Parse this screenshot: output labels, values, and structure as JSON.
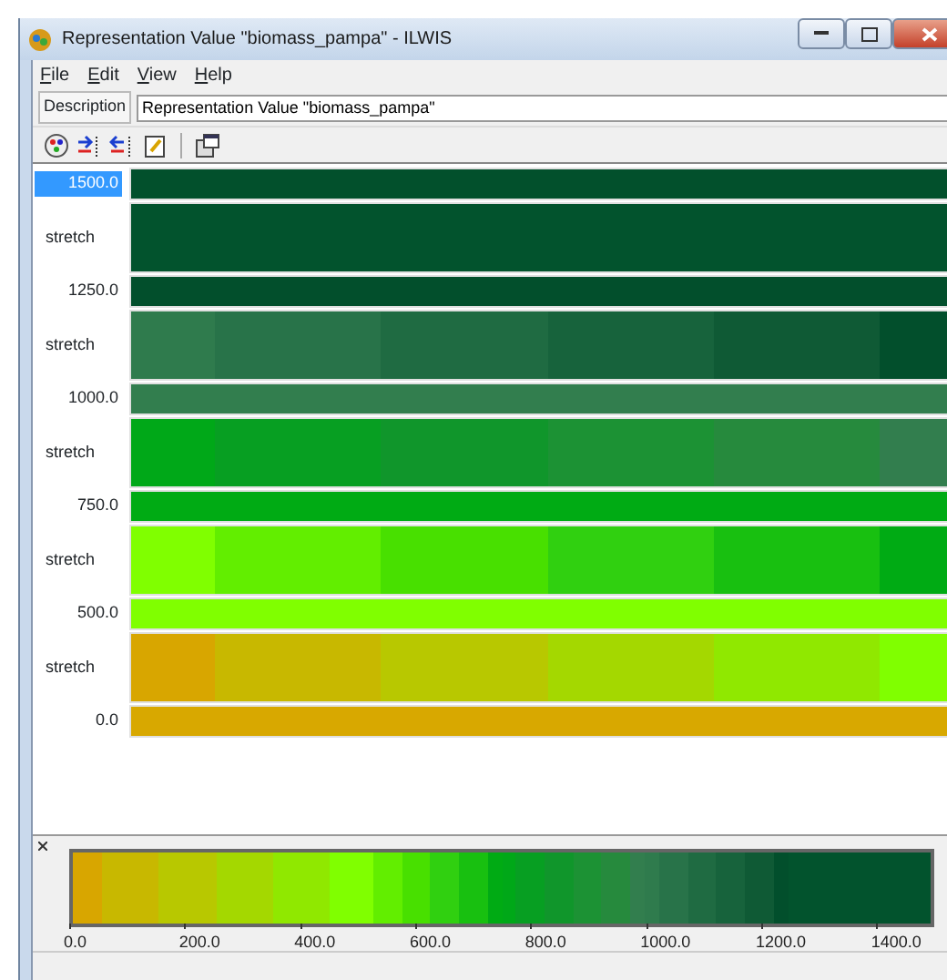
{
  "window": {
    "title": "Representation Value \"biomass_pampa\" - ILWIS"
  },
  "menu": [
    "File",
    "Edit",
    "View",
    "Help"
  ],
  "description": {
    "label": "Description",
    "value": "Representation Value \"biomass_pampa\""
  },
  "rows": [
    {
      "kind": "value",
      "label": "1500.0",
      "color": "#02502c",
      "selected": true
    },
    {
      "kind": "stretch",
      "label": "stretch",
      "segments": [
        {
          "color": "#02532d"
        },
        {
          "color": "#02532d"
        },
        {
          "color": "#02532d"
        },
        {
          "color": "#02532d"
        },
        {
          "color": "#02532d"
        },
        {
          "color": "#02532d"
        }
      ]
    },
    {
      "kind": "value",
      "label": "1250.0",
      "color": "#024f2c",
      "selected": false
    },
    {
      "kind": "stretch",
      "label": "stretch",
      "segments": [
        {
          "color": "#2f7b4d"
        },
        {
          "color": "#287349"
        },
        {
          "color": "#1f6b42"
        },
        {
          "color": "#17633c"
        },
        {
          "color": "#0f5a35"
        },
        {
          "color": "#024f2c"
        }
      ]
    },
    {
      "kind": "value",
      "label": "1000.0",
      "color": "#327e4e",
      "selected": false
    },
    {
      "kind": "stretch",
      "label": "stretch",
      "segments": [
        {
          "color": "#00a818"
        },
        {
          "color": "#079f22"
        },
        {
          "color": "#10962b"
        },
        {
          "color": "#1c9234"
        },
        {
          "color": "#268a3d"
        },
        {
          "color": "#327e4e"
        }
      ]
    },
    {
      "kind": "value",
      "label": "750.0",
      "color": "#00ab14",
      "selected": false
    },
    {
      "kind": "stretch",
      "label": "stretch",
      "segments": [
        {
          "color": "#80ff00"
        },
        {
          "color": "#62ee00"
        },
        {
          "color": "#48e000"
        },
        {
          "color": "#30d010"
        },
        {
          "color": "#18c010"
        },
        {
          "color": "#00ab14"
        }
      ]
    },
    {
      "kind": "value",
      "label": "500.0",
      "color": "#80ff00",
      "selected": false
    },
    {
      "kind": "stretch",
      "label": "stretch",
      "segments": [
        {
          "color": "#d8a600"
        },
        {
          "color": "#c8b800"
        },
        {
          "color": "#b8c800"
        },
        {
          "color": "#a4d800"
        },
        {
          "color": "#90e800"
        },
        {
          "color": "#80ff00"
        }
      ]
    },
    {
      "kind": "value",
      "label": "0.0",
      "color": "#d8a800",
      "selected": false
    }
  ],
  "legend": {
    "ticks": [
      "0.0",
      "200.0",
      "400.0",
      "600.0",
      "800.0",
      "1000.0",
      "1200.0",
      "1400.0"
    ]
  }
}
